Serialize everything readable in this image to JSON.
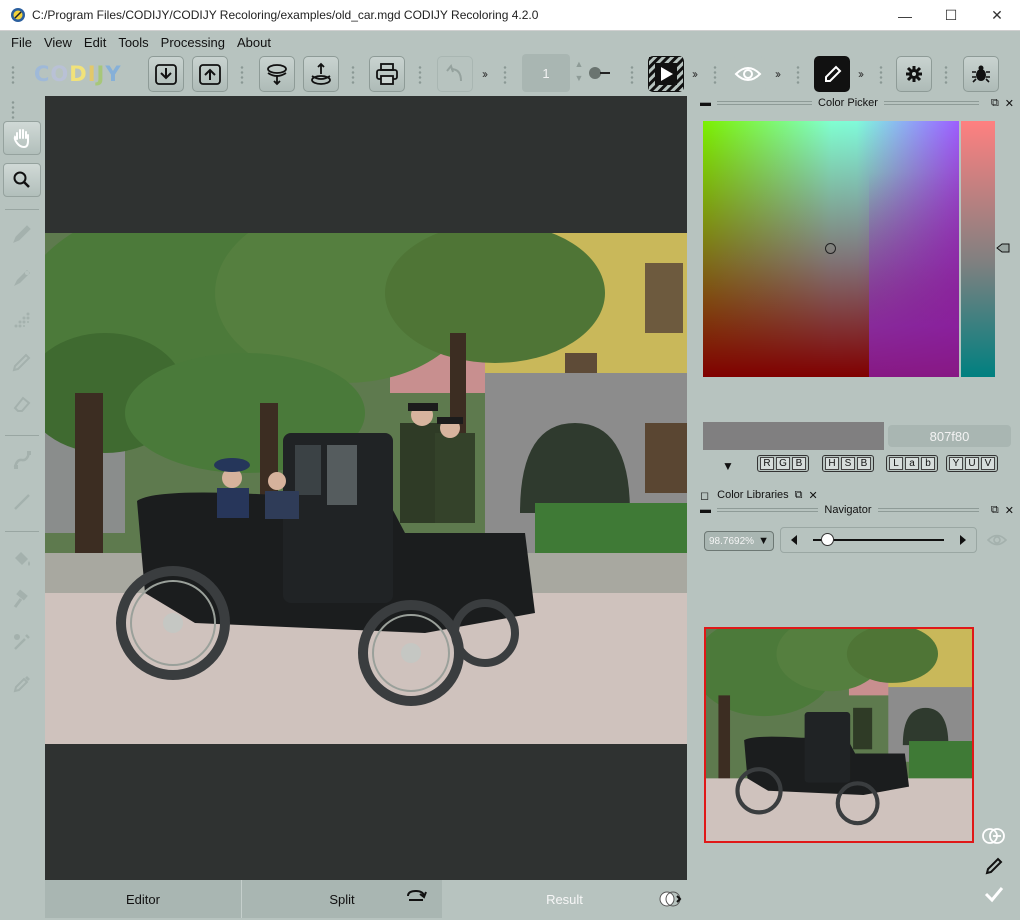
{
  "window": {
    "title": "C:/Program Files/CODIJY/CODIJY Recoloring/examples/old_car.mgd CODIJY Recoloring 4.2.0",
    "minimize": "—",
    "maximize": "☐",
    "close": "✕"
  },
  "menu": [
    "File",
    "View",
    "Edit",
    "Tools",
    "Processing",
    "About"
  ],
  "toolbar": {
    "logo": "CODIJY",
    "frame_value": "1"
  },
  "color_picker": {
    "title": "Color Picker",
    "hex": "807f80",
    "swatch_color": "#807f80",
    "models": [
      [
        "R",
        "G",
        "B"
      ],
      [
        "H",
        "S",
        "B"
      ],
      [
        "L",
        "a",
        "b"
      ],
      [
        "Y",
        "U",
        "V"
      ]
    ]
  },
  "color_libraries": {
    "title": "Color Libraries"
  },
  "navigator": {
    "title": "Navigator",
    "zoom": "98.7692%"
  },
  "bottom_tabs": {
    "editor": "Editor",
    "split": "Split",
    "result": "Result"
  },
  "colors": {
    "background": "#b7c3bf",
    "canvas": "#2f3231",
    "thumb_border": "#e01818"
  }
}
